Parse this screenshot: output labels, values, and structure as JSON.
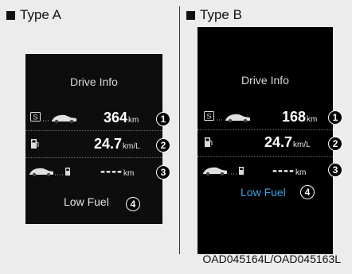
{
  "section_a": {
    "marker": "■",
    "title": "Type A"
  },
  "section_b": {
    "marker": "■",
    "title": "Type B"
  },
  "panel_a": {
    "title": "Drive Info",
    "range": {
      "value": "364",
      "unit": "km",
      "callout": "1"
    },
    "efficiency": {
      "value": "24.7",
      "unit": "km/L",
      "callout": "2"
    },
    "distance_since_refuel": {
      "value": "----",
      "unit": "km",
      "callout": "3"
    },
    "low_fuel": {
      "text": "Low Fuel",
      "callout": "4",
      "color": "#e6e6e6"
    }
  },
  "panel_b": {
    "title": "Drive Info",
    "range": {
      "value": "168",
      "unit": "km",
      "callout": "1"
    },
    "efficiency": {
      "value": "24.7",
      "unit": "km/L",
      "callout": "2"
    },
    "distance_since_refuel": {
      "value": "----",
      "unit": "km",
      "callout": "3"
    },
    "low_fuel": {
      "text": "Low Fuel",
      "callout": "4",
      "color": "#3aa3e0"
    }
  },
  "footer_code": "OAD045164L/OAD045163L",
  "icons": {
    "range_badge": "s-badge-icon",
    "car": "car-icon",
    "fuel_pump": "fuel-pump-icon"
  }
}
